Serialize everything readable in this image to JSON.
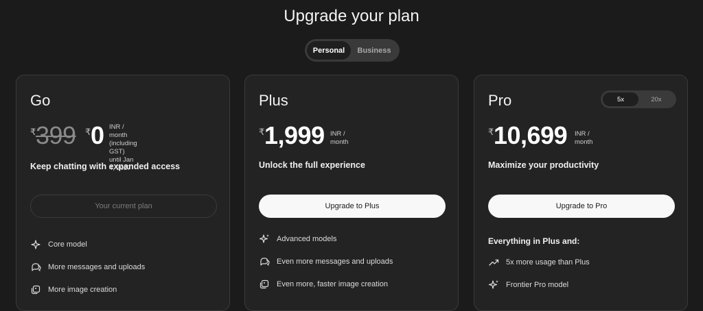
{
  "page": {
    "title": "Upgrade your plan"
  },
  "plan_type_toggle": {
    "options": [
      "Personal",
      "Business"
    ],
    "selected": "Personal"
  },
  "plans": {
    "go": {
      "name": "Go",
      "currency": "₹",
      "old_price": "399",
      "price": "0",
      "price_note_1": "INR /",
      "price_note_2": "month (including GST)",
      "price_note_3": "until Jan 4, 2027",
      "tagline": "Keep chatting with expanded access",
      "cta": "Your current plan",
      "features": [
        "Core model",
        "More messages and uploads",
        "More image creation"
      ]
    },
    "plus": {
      "name": "Plus",
      "currency": "₹",
      "price": "1,999",
      "price_note_1": "INR /",
      "price_note_2": "month",
      "tagline": "Unlock the full experience",
      "cta": "Upgrade to Plus",
      "features": [
        "Advanced models",
        "Even more messages and uploads",
        "Even more, faster image creation"
      ]
    },
    "pro": {
      "name": "Pro",
      "usage_toggle": {
        "options": [
          "5x",
          "20x"
        ],
        "selected": "5x"
      },
      "currency": "₹",
      "price": "10,699",
      "price_note_1": "INR /",
      "price_note_2": "month",
      "tagline": "Maximize your productivity",
      "cta": "Upgrade to Pro",
      "features_heading": "Everything in Plus and:",
      "features": [
        "5x more usage than Plus",
        "Frontier Pro model"
      ]
    }
  },
  "icons": {
    "core_model": "sparkle-icon",
    "messages": "chat-bubbles-icon",
    "images": "image-stack-icon",
    "trend": "trend-up-icon",
    "advanced": "sparkles-icon"
  }
}
